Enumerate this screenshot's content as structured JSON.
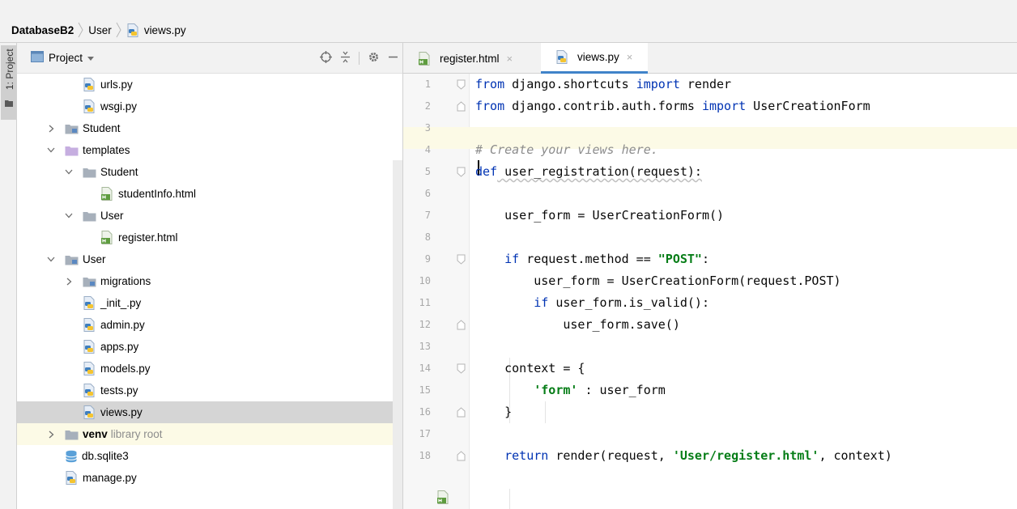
{
  "breadcrumb": {
    "project": "DatabaseB2",
    "folder": "User",
    "file": "views.py"
  },
  "side_tab": {
    "label": "1: Project"
  },
  "project_panel": {
    "title": "Project",
    "tree": [
      {
        "label": "urls.py",
        "icon": "python-file-icon",
        "indent": 3,
        "arrow": ""
      },
      {
        "label": "wsgi.py",
        "icon": "python-file-icon",
        "indent": 3,
        "arrow": ""
      },
      {
        "label": "Student",
        "icon": "module-folder-icon",
        "indent": 2,
        "arrow": "collapsed"
      },
      {
        "label": "templates",
        "icon": "templates-folder-icon",
        "indent": 2,
        "arrow": "expanded"
      },
      {
        "label": "Student",
        "icon": "folder-icon",
        "indent": 3,
        "arrow": "expanded"
      },
      {
        "label": "studentInfo.html",
        "icon": "html-file-icon",
        "indent": 4,
        "arrow": ""
      },
      {
        "label": "User",
        "icon": "folder-icon",
        "indent": 3,
        "arrow": "expanded"
      },
      {
        "label": "register.html",
        "icon": "html-file-icon",
        "indent": 4,
        "arrow": ""
      },
      {
        "label": "User",
        "icon": "module-folder-icon",
        "indent": 2,
        "arrow": "expanded"
      },
      {
        "label": "migrations",
        "icon": "module-folder-icon",
        "indent": 3,
        "arrow": "collapsed"
      },
      {
        "label": "_init_.py",
        "icon": "python-file-icon",
        "indent": 3,
        "arrow": ""
      },
      {
        "label": "admin.py",
        "icon": "python-file-icon",
        "indent": 3,
        "arrow": ""
      },
      {
        "label": "apps.py",
        "icon": "python-file-icon",
        "indent": 3,
        "arrow": ""
      },
      {
        "label": "models.py",
        "icon": "python-file-icon",
        "indent": 3,
        "arrow": ""
      },
      {
        "label": "tests.py",
        "icon": "python-file-icon",
        "indent": 3,
        "arrow": ""
      },
      {
        "label": "views.py",
        "icon": "python-file-icon",
        "indent": 3,
        "arrow": "",
        "selected": true
      },
      {
        "label": "venv",
        "note": "library root",
        "icon": "folder-icon",
        "indent": 2,
        "arrow": "collapsed",
        "venv": true
      },
      {
        "label": "db.sqlite3",
        "icon": "database-icon",
        "indent": 2,
        "arrow": ""
      },
      {
        "label": "manage.py",
        "icon": "python-file-icon",
        "indent": 2,
        "arrow": ""
      }
    ]
  },
  "editor": {
    "tabs": [
      {
        "label": "register.html",
        "icon": "html-file-icon",
        "active": false
      },
      {
        "label": "views.py",
        "icon": "python-file-icon",
        "active": true
      }
    ],
    "active_line": 3,
    "lines": [
      {
        "num": "1",
        "fold": "start",
        "tokens": [
          {
            "t": "from",
            "c": "kw"
          },
          {
            "t": " django.shortcuts "
          },
          {
            "t": "import",
            "c": "kw"
          },
          {
            "t": " render"
          }
        ]
      },
      {
        "num": "2",
        "fold": "end",
        "tokens": [
          {
            "t": "from",
            "c": "kw"
          },
          {
            "t": " django.contrib.auth.forms "
          },
          {
            "t": "import",
            "c": "kw"
          },
          {
            "t": " UserCreationForm"
          }
        ]
      },
      {
        "num": "3",
        "fold": "",
        "tokens": []
      },
      {
        "num": "4",
        "fold": "",
        "tokens": [
          {
            "t": "# Create your views here.",
            "c": "cmt"
          }
        ]
      },
      {
        "num": "5",
        "fold": "start",
        "tokens": [
          {
            "t": "def",
            "c": "kw"
          },
          {
            "t": " user_registration(request):",
            "c": "squig"
          }
        ]
      },
      {
        "num": "6",
        "fold": "",
        "tokens": []
      },
      {
        "num": "7",
        "fold": "",
        "tokens": [
          {
            "t": "    user_form = UserCreationForm()"
          }
        ]
      },
      {
        "num": "8",
        "fold": "",
        "tokens": []
      },
      {
        "num": "9",
        "fold": "start",
        "tokens": [
          {
            "t": "    "
          },
          {
            "t": "if",
            "c": "kw"
          },
          {
            "t": " request.method == "
          },
          {
            "t": "\"POST\"",
            "c": "str"
          },
          {
            "t": ":"
          }
        ]
      },
      {
        "num": "10",
        "fold": "",
        "tokens": [
          {
            "t": "        user_form = UserCreationForm(request.POST)"
          }
        ]
      },
      {
        "num": "11",
        "fold": "",
        "tokens": [
          {
            "t": "        "
          },
          {
            "t": "if",
            "c": "kw"
          },
          {
            "t": " user_form.is_valid():"
          }
        ]
      },
      {
        "num": "12",
        "fold": "end",
        "tokens": [
          {
            "t": "            user_form.save()"
          }
        ]
      },
      {
        "num": "13",
        "fold": "",
        "tokens": []
      },
      {
        "num": "14",
        "fold": "start",
        "tokens": [
          {
            "t": "    context = {"
          }
        ]
      },
      {
        "num": "15",
        "fold": "",
        "tokens": [
          {
            "t": "        "
          },
          {
            "t": "'form'",
            "c": "str"
          },
          {
            "t": " : user_form"
          }
        ]
      },
      {
        "num": "16",
        "fold": "end",
        "tokens": [
          {
            "t": "    }"
          }
        ]
      },
      {
        "num": "17",
        "fold": "",
        "tokens": []
      },
      {
        "num": "18",
        "fold": "end",
        "tokens": [
          {
            "t": "    "
          },
          {
            "t": "return",
            "c": "kw"
          },
          {
            "t": " render(request, "
          },
          {
            "t": "'User/register.html'",
            "c": "str"
          },
          {
            "t": ", context)"
          }
        ]
      }
    ]
  },
  "colors": {
    "keyword": "#0033b3",
    "string": "#067d17",
    "comment": "#8c8c8c",
    "selection": "#d5d5d5",
    "current_line": "#fcfae6",
    "tab_underline": "#4083c9"
  }
}
